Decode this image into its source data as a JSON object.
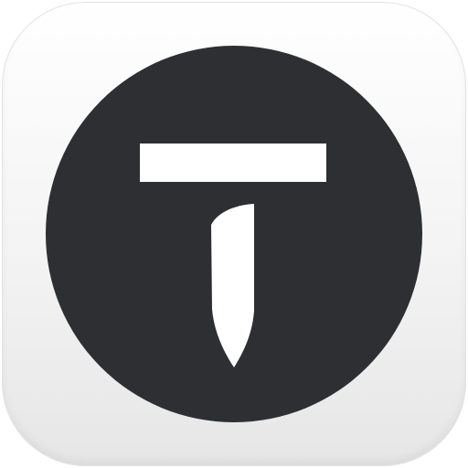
{
  "app_icon": {
    "icon": "letter-t-pen-logo",
    "tile_color": "#f2f2f2",
    "circle_color": "#2e2f33",
    "glyph_color": "#ffffff"
  }
}
